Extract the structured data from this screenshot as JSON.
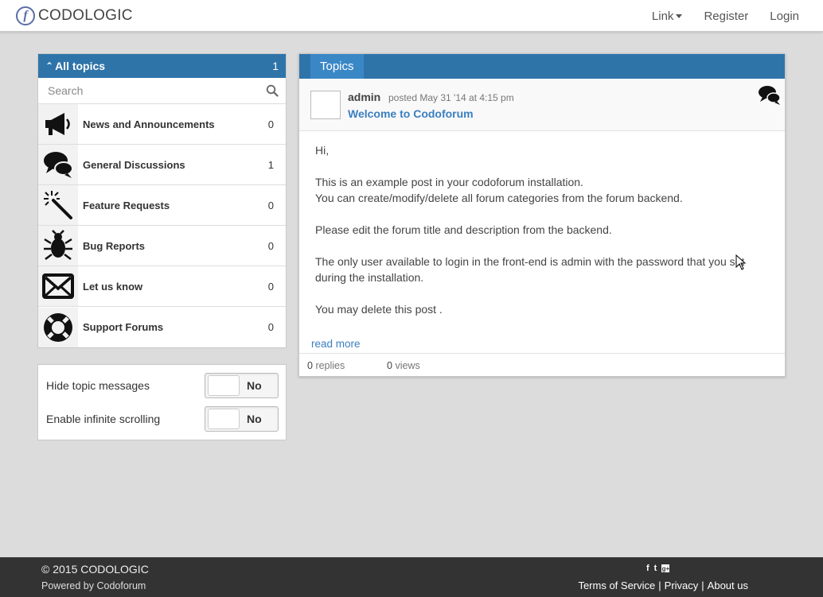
{
  "brand": {
    "logo_letter": "f",
    "name": "CODOLOGIC"
  },
  "nav": {
    "link_label": "Link",
    "register_label": "Register",
    "login_label": "Login"
  },
  "sidebar": {
    "header": {
      "label": "All topics",
      "count": "1"
    },
    "search": {
      "placeholder": "Search"
    },
    "categories": [
      {
        "name": "News and Announcements",
        "count": "0",
        "icon": "megaphone-icon"
      },
      {
        "name": "General Discussions",
        "count": "1",
        "icon": "chat-bubbles-icon"
      },
      {
        "name": "Feature Requests",
        "count": "0",
        "icon": "magic-wand-icon"
      },
      {
        "name": "Bug Reports",
        "count": "0",
        "icon": "bug-icon"
      },
      {
        "name": "Let us know",
        "count": "0",
        "icon": "envelope-icon"
      },
      {
        "name": "Support Forums",
        "count": "0",
        "icon": "lifebuoy-icon"
      }
    ]
  },
  "options": {
    "hide_topic_messages": {
      "label": "Hide topic messages",
      "value": "No"
    },
    "infinite_scrolling": {
      "label": "Enable infinite scrolling",
      "value": "No"
    }
  },
  "topics": {
    "tab_label": "Topics",
    "post": {
      "author": "admin",
      "posted": "posted May 31 '14 at 4:15 pm",
      "title": "Welcome to Codoforum",
      "body": [
        "Hi,",
        "This is an example post in your codoforum installation.",
        "You can create/modify/delete all forum categories from the forum backend.",
        "Please edit the forum title and description from the backend.",
        "The only user available to login in the front-end is admin with the password that you set during the installation.",
        "You may delete this post ."
      ],
      "read_more": "read more",
      "replies_count": "0",
      "replies_label": "replies",
      "views_count": "0",
      "views_label": "views"
    }
  },
  "footer": {
    "copyright": "© 2015 CODOLOGIC",
    "powered_by": "Powered by Codoforum",
    "social": {
      "facebook": "f",
      "twitter": "t",
      "googleplus": "g+"
    },
    "links": {
      "terms": "Terms of Service",
      "privacy": "Privacy",
      "about": "About us",
      "separator": "|"
    }
  },
  "colors": {
    "primary": "#2f74a9",
    "tab": "#3a87c6",
    "link": "#3a7fc0",
    "footer_bg": "#333333",
    "page_bg": "#dcdcdc"
  }
}
